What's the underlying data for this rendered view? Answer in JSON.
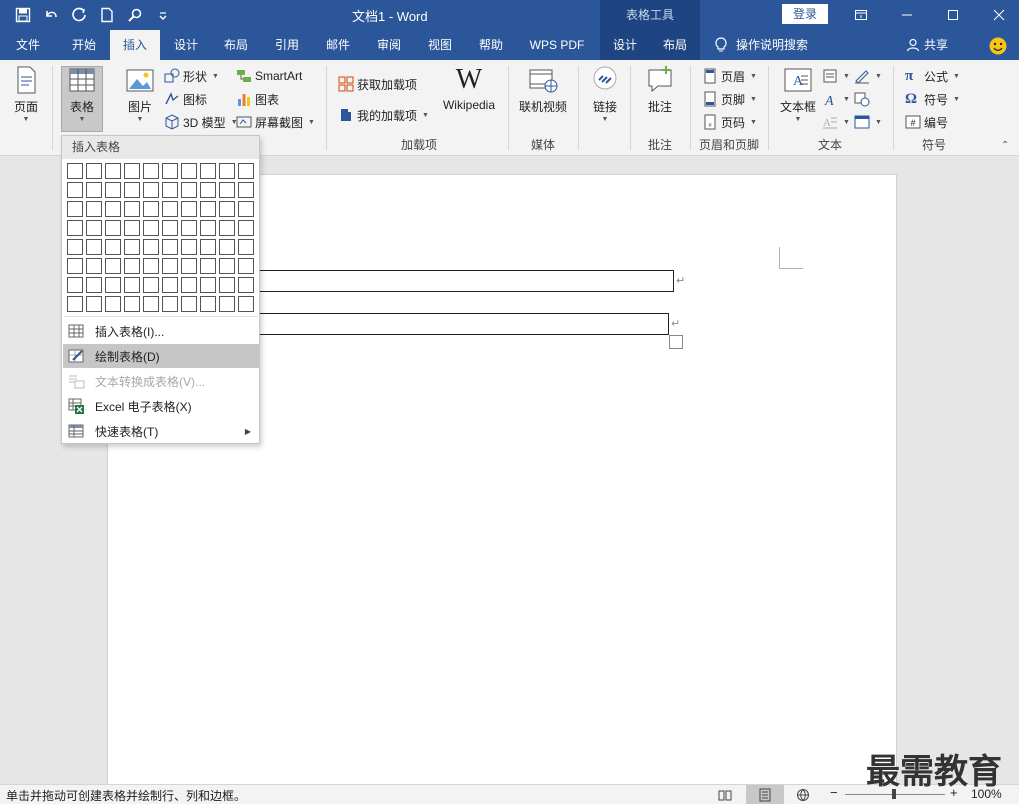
{
  "titlebar": {
    "title": "文档1 - Word",
    "context_band": "表格工具",
    "login": "登录"
  },
  "tabs": [
    "文件",
    "开始",
    "插入",
    "设计",
    "布局",
    "引用",
    "邮件",
    "审阅",
    "视图",
    "帮助",
    "WPS PDF",
    "设计",
    "布局"
  ],
  "active_tab": "插入",
  "tell_me": "操作说明搜索",
  "share": "共享",
  "ribbon": {
    "pages_label": "页面",
    "table_label": "表格",
    "picture_label": "图片",
    "shapes": "形状",
    "icons": "图标",
    "model3d": "3D 模型",
    "smartart": "SmartArt",
    "chart": "图表",
    "screenshot": "屏幕截图",
    "get_addins": "获取加载项",
    "my_addins": "我的加载项",
    "wikipedia": "Wikipedia",
    "addins_group": "加载项",
    "online_video": "联机视频",
    "media_group": "媒体",
    "link": "链接",
    "comment": "批注",
    "comment_group": "批注",
    "header": "页眉",
    "footer": "页脚",
    "page_number": "页码",
    "header_footer_group": "页眉和页脚",
    "textbox": "文本框",
    "text_group": "文本",
    "equation": "公式",
    "symbol": "符号",
    "numbering": "编号",
    "symbols_group": "符号"
  },
  "menu": {
    "header": "插入表格",
    "items": [
      {
        "label": "插入表格(I)..."
      },
      {
        "label": "绘制表格(D)"
      },
      {
        "label": "文本转换成表格(V)..."
      },
      {
        "label": "Excel 电子表格(X)"
      },
      {
        "label": "快速表格(T)"
      }
    ],
    "grid_cols": 10,
    "grid_rows": 8
  },
  "status": {
    "text": "单击并拖动可创建表格并绘制行、列和边框。",
    "zoom": "100%"
  },
  "watermark": "最需教育",
  "colors": {
    "accent": "#2b579a",
    "context": "#1e4581",
    "ribbon_bg": "#f3f3f3",
    "highlight": "#c6c6c6"
  }
}
